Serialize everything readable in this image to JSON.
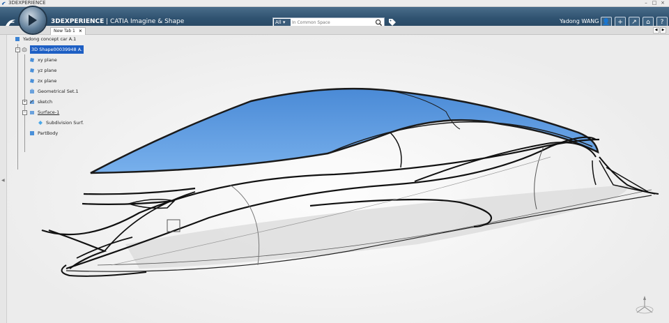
{
  "window": {
    "title": "3DEXPERIENCE"
  },
  "appbar": {
    "brand_bold": "3DEXPERIENCE",
    "brand_rest": " | CATIA Imagine & Shape",
    "search_scope": "All",
    "search_placeholder": "In Common Space",
    "user": "Yadong WANG"
  },
  "tabs": [
    {
      "label": "New Tab 1"
    }
  ],
  "tree": {
    "root": "Yadong concept car A.1",
    "shape": "3D Shape00039948 A.",
    "items": [
      "xy plane",
      "yz plane",
      "zx plane",
      "Geometrical Set.1",
      "sketch",
      "Surface-1",
      "Subdivision Surf.",
      "PartBody"
    ]
  },
  "colors": {
    "selection": "#1e5fc4",
    "surface": "#5b9be0",
    "appbar": "#2f5270"
  },
  "icons": [
    "ds-logo-icon",
    "compass-icon",
    "search-icon",
    "tag-icon",
    "user-icon",
    "add-icon",
    "share-icon",
    "home-icon",
    "help-icon",
    "compass3d-icon"
  ]
}
